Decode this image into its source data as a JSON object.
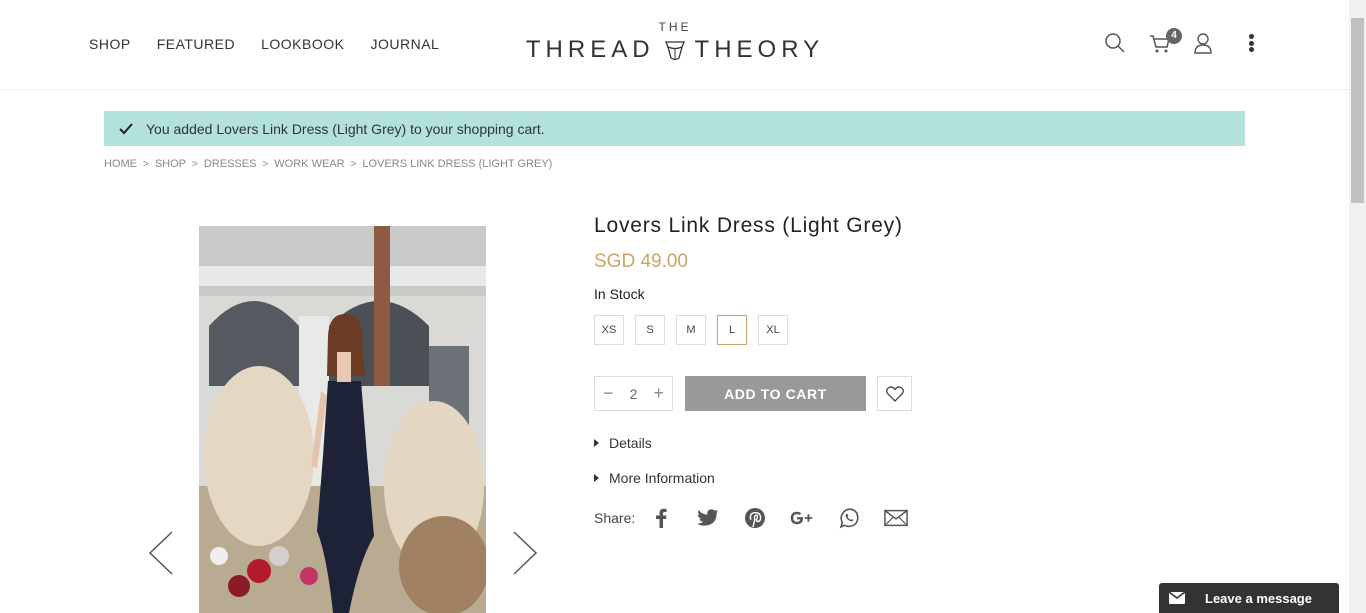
{
  "nav": {
    "items": [
      {
        "label": "SHOP"
      },
      {
        "label": "FEATURED"
      },
      {
        "label": "LOOKBOOK"
      },
      {
        "label": "JOURNAL"
      }
    ]
  },
  "logo": {
    "top": "THE",
    "left_word": "THREAD",
    "right_word": "THEORY"
  },
  "header": {
    "cart_count": "4"
  },
  "message": {
    "text": "You added Lovers Link Dress (Light Grey) to your shopping cart."
  },
  "breadcrumb": {
    "items": [
      "HOME",
      "SHOP",
      "DRESSES",
      "WORK WEAR",
      "LOVERS LINK DRESS (LIGHT GREY)"
    ],
    "separator": ">"
  },
  "product": {
    "name": "Lovers Link Dress (Light Grey)",
    "price": "SGD 49.00",
    "stock": "In Stock",
    "sizes": [
      "XS",
      "S",
      "M",
      "L",
      "XL"
    ],
    "selected_size": "L",
    "quantity": "2",
    "qty_minus": "−",
    "qty_plus": "+",
    "add_to_cart": "ADD TO CART",
    "details_label": "Details",
    "more_info_label": "More Information",
    "share_label": "Share:"
  },
  "icons": {
    "search": "search-icon",
    "cart": "cart-icon",
    "account": "user-icon",
    "menu": "kebab-menu-icon",
    "share": [
      "facebook-icon",
      "twitter-icon",
      "pinterest-icon",
      "google-plus-icon",
      "whatsapp-icon",
      "email-icon"
    ]
  },
  "chat": {
    "label": "Leave a message"
  },
  "colors": {
    "accent": "#c9a46a",
    "message_bg": "#b3e2dd",
    "button_bg": "#999999",
    "chat_bg": "#333333"
  }
}
